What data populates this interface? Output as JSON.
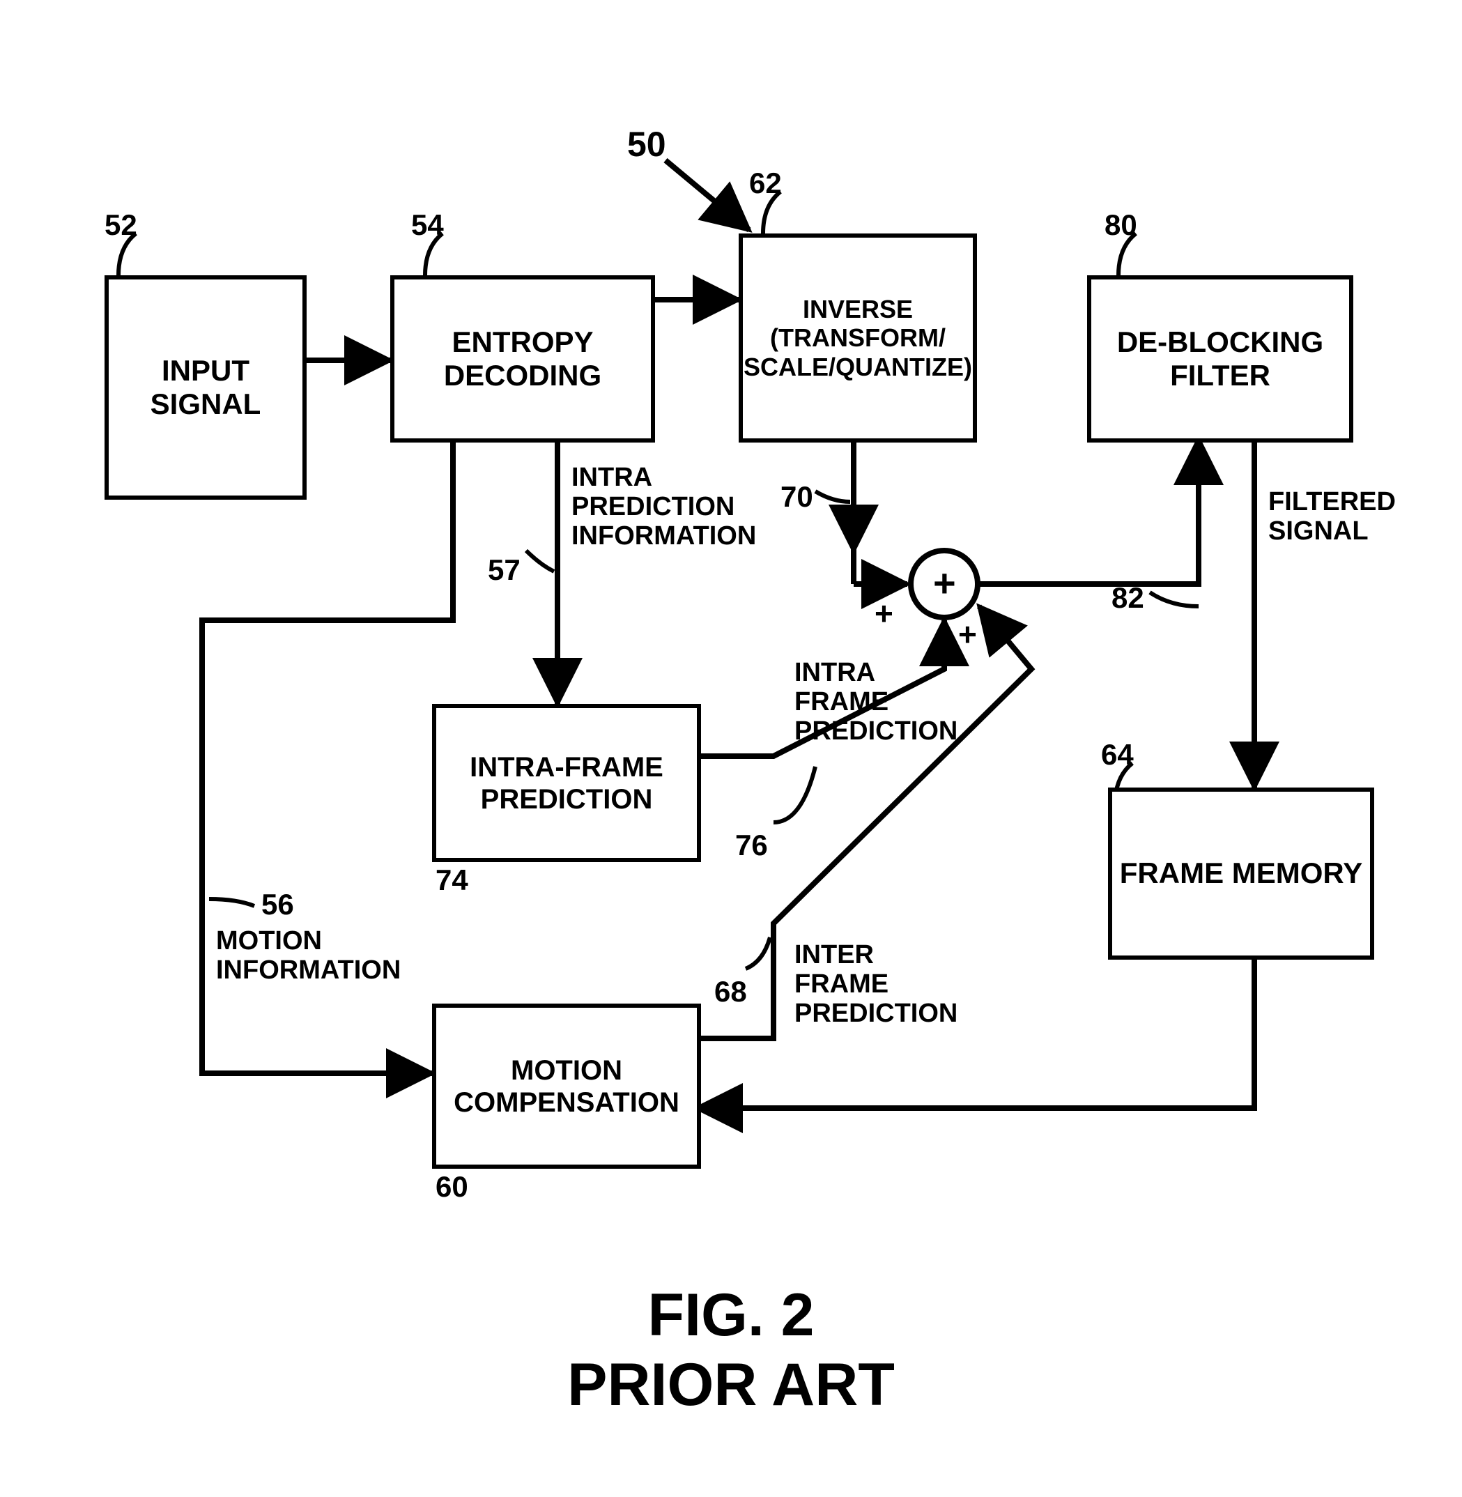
{
  "figure": {
    "id_label": "50",
    "caption_line1": "FIG. 2",
    "caption_line2": "PRIOR ART"
  },
  "blocks": {
    "input_signal": {
      "ref": "52",
      "label": "INPUT\nSIGNAL"
    },
    "entropy": {
      "ref": "54",
      "label": "ENTROPY\nDECODING"
    },
    "inverse": {
      "ref": "62",
      "label": "INVERSE\n(TRANSFORM/\nSCALE/QUANTIZE)"
    },
    "deblock": {
      "ref": "80",
      "label": "DE-BLOCKING\nFILTER"
    },
    "intra": {
      "ref": "74",
      "label": "INTRA-FRAME\nPREDICTION"
    },
    "motion_comp": {
      "ref": "60",
      "label": "MOTION\nCOMPENSATION"
    },
    "frame_mem": {
      "ref": "64",
      "label": "FRAME\nMEMORY"
    }
  },
  "signals": {
    "intra_pred_info": {
      "ref": "57",
      "label": "INTRA\nPREDICTION\nINFORMATION"
    },
    "motion_info": {
      "ref": "56",
      "label": "MOTION\nINFORMATION"
    },
    "inverse_out": {
      "ref": "70"
    },
    "intra_frame_pred": {
      "ref": "76",
      "label": "INTRA\nFRAME\nPREDICTION"
    },
    "inter_frame_pred": {
      "ref": "68",
      "label": "INTER\nFRAME\nPREDICTION"
    },
    "filtered": {
      "ref": "82",
      "label": "FILTERED\nSIGNAL"
    }
  },
  "adder": {
    "plus_center": "+",
    "plus_left": "+",
    "plus_bottom": "+"
  }
}
